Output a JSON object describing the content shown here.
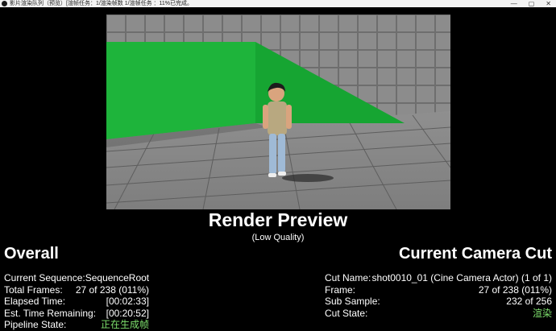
{
  "window": {
    "title": "影片渲染队列（预览）[渲帧任务：1/渲染帧数 1/渲帧任务 ：11%已完成。",
    "controls": [
      "—",
      "▢",
      "✕"
    ]
  },
  "preview": {
    "title": "Render Preview",
    "subtitle": "(Low Quality)"
  },
  "overall": {
    "heading": "Overall",
    "rows": [
      {
        "label": "Current Sequence:",
        "value": "SequenceRoot"
      },
      {
        "label": "Total Frames:",
        "value": "27 of 238 (011%)"
      },
      {
        "label": "Elapsed Time:",
        "value": "[00:02:33]"
      },
      {
        "label": "Est. Time Remaining:",
        "value": "[00:20:52]"
      },
      {
        "label": "Pipeline State:",
        "value": "正在生成帧"
      }
    ]
  },
  "camera_cut": {
    "heading": "Current Camera Cut",
    "rows": [
      {
        "label": "Cut Name:",
        "value": "shot0010_01 (Cine Camera Actor) (1 of 1)"
      },
      {
        "label": "Frame:",
        "value": "27 of 238 (011%)"
      },
      {
        "label": "Sub Sample:",
        "value": "232 of 256"
      },
      {
        "label": "Cut State:",
        "value": "渲染"
      }
    ]
  },
  "colors": {
    "status_green": "#7ee06d",
    "greenscreen": "#1db23a"
  }
}
